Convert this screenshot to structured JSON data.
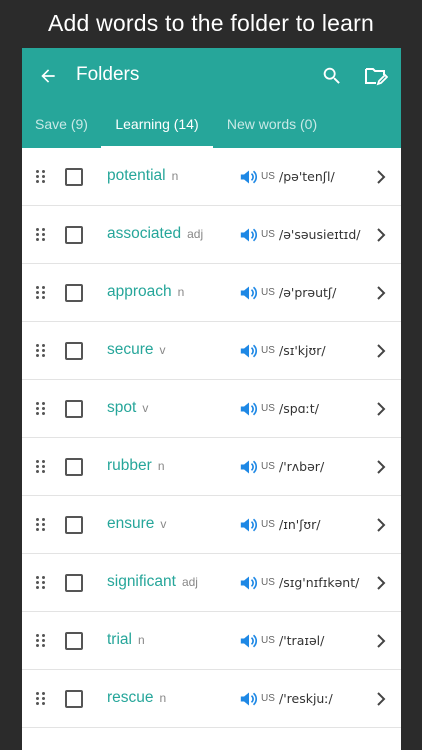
{
  "caption": "Add words to the folder to learn",
  "appbar": {
    "title": "Folders",
    "color": "#26a69a"
  },
  "tabs": [
    {
      "label": "Save (9)",
      "active": false
    },
    {
      "label": "Learning (14)",
      "active": true
    },
    {
      "label": "New words (0)",
      "active": false
    }
  ],
  "icons": {
    "back": "arrow-back-icon",
    "search": "search-icon",
    "folder": "edit-folder-icon",
    "drag": "drag-handle-icon",
    "speaker": "speaker-icon",
    "chevron": "chevron-right-icon"
  },
  "words": [
    {
      "word": "potential",
      "pos": "n",
      "accent": "US",
      "ipa": "/pə'tenʃl/"
    },
    {
      "word": "associated",
      "pos": "adj",
      "accent": "US",
      "ipa": "/ə'səusieɪtɪd/"
    },
    {
      "word": "approach",
      "pos": "n",
      "accent": "US",
      "ipa": "/ə'prəutʃ/"
    },
    {
      "word": "secure",
      "pos": "v",
      "accent": "US",
      "ipa": "/sɪ'kjʊr/"
    },
    {
      "word": "spot",
      "pos": "v",
      "accent": "US",
      "ipa": "/spɑːt/"
    },
    {
      "word": "rubber",
      "pos": "n",
      "accent": "US",
      "ipa": "/'rʌbər/"
    },
    {
      "word": "ensure",
      "pos": "v",
      "accent": "US",
      "ipa": "/ɪn'ʃʊr/"
    },
    {
      "word": "significant",
      "pos": "adj",
      "accent": "US",
      "ipa": "/sɪg'nɪfɪkənt/"
    },
    {
      "word": "trial",
      "pos": "n",
      "accent": "US",
      "ipa": "/'traɪəl/"
    },
    {
      "word": "rescue",
      "pos": "n",
      "accent": "US",
      "ipa": "/'reskjuː/"
    }
  ]
}
